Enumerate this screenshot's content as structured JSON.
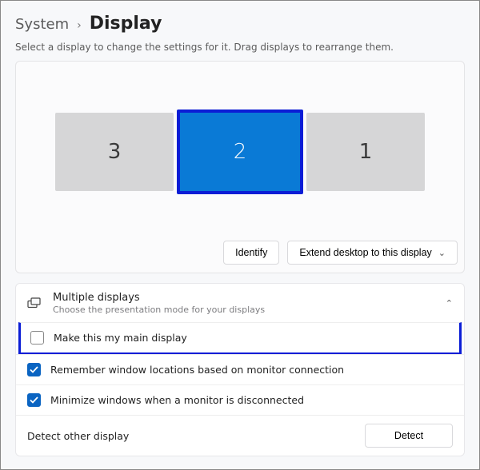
{
  "breadcrumb": {
    "parent": "System",
    "separator": "›",
    "current": "Display"
  },
  "instruction": "Select a display to change the settings for it. Drag displays to rearrange them.",
  "monitors": {
    "left": "3",
    "center": "2",
    "right": "1"
  },
  "arrange_actions": {
    "identify": "Identify",
    "mode_dropdown": "Extend desktop to this display"
  },
  "multiple_displays": {
    "title": "Multiple displays",
    "subtitle": "Choose the presentation mode for your displays",
    "main_display": "Make this my main display",
    "remember_locations": "Remember window locations based on monitor connection",
    "minimize_disconnect": "Minimize windows when a monitor is disconnected",
    "detect_label": "Detect other display",
    "detect_button": "Detect"
  }
}
